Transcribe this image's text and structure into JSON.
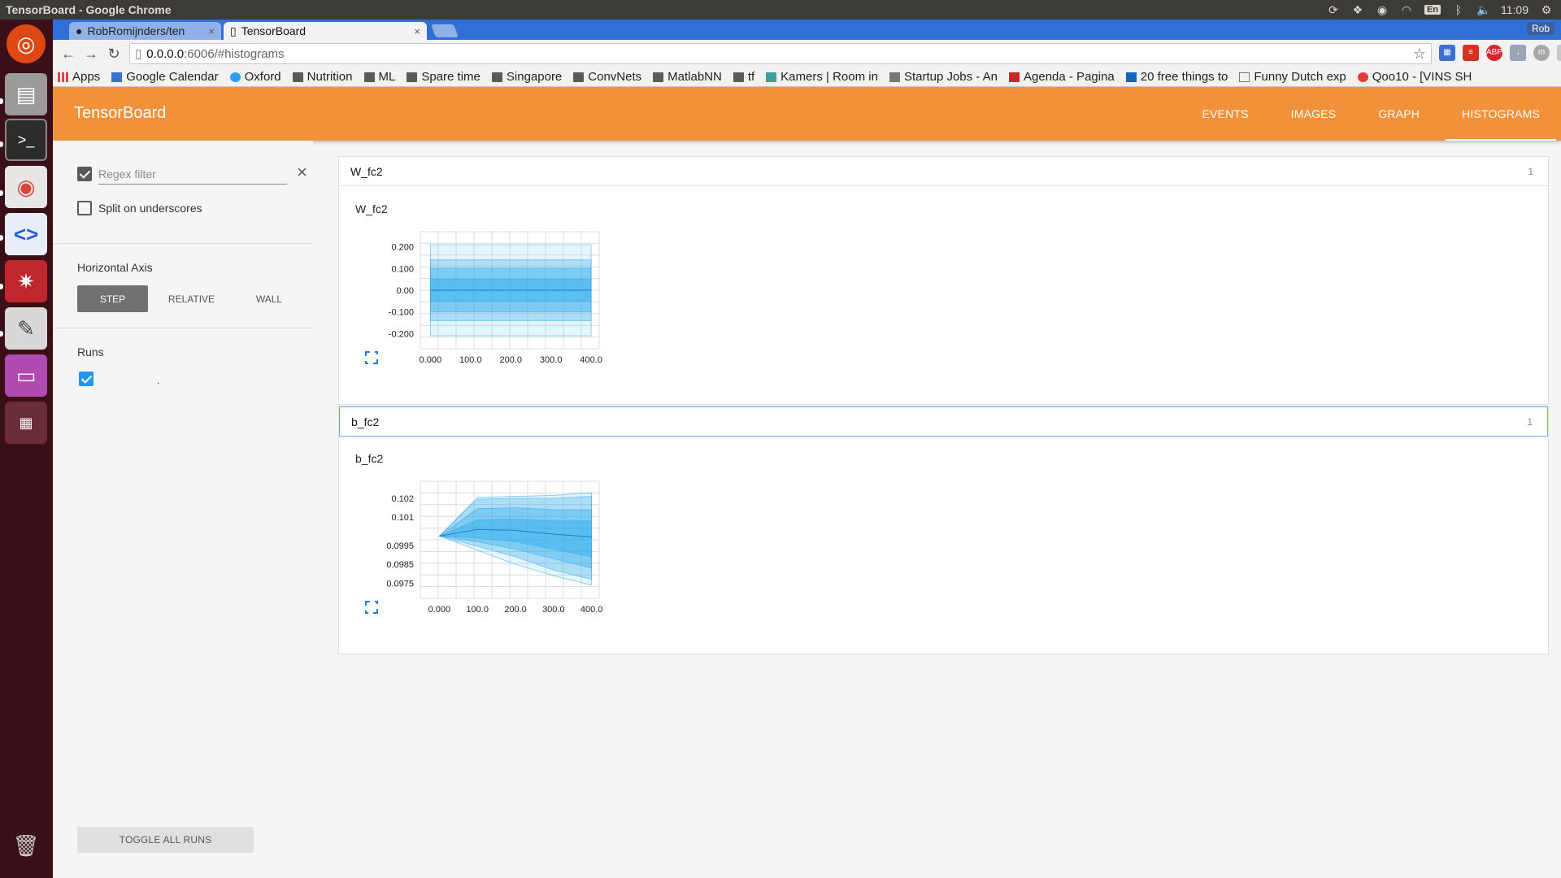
{
  "os": {
    "window_title": "TensorBoard - Google Chrome",
    "clock": "11:09",
    "keyboard_lang": "En"
  },
  "browser": {
    "tabs": [
      {
        "label": "RobRomijnders/ten",
        "active": false
      },
      {
        "label": "TensorBoard",
        "active": true
      }
    ],
    "user": "Rob",
    "url_host": "0.0.0.0",
    "url_path": ":6006/#histograms",
    "bookmarks": [
      {
        "label": "Apps",
        "icon": "apps-grid-icon"
      },
      {
        "label": "Google Calendar",
        "icon": "calendar-icon"
      },
      {
        "label": "Oxford",
        "icon": "oxford-icon"
      },
      {
        "label": "Nutrition",
        "icon": "folder-icon"
      },
      {
        "label": "ML",
        "icon": "folder-icon"
      },
      {
        "label": "Spare time",
        "icon": "folder-icon"
      },
      {
        "label": "Singapore",
        "icon": "folder-icon"
      },
      {
        "label": "ConvNets",
        "icon": "folder-icon"
      },
      {
        "label": "MatlabNN",
        "icon": "folder-icon"
      },
      {
        "label": "tf",
        "icon": "folder-icon"
      },
      {
        "label": "Kamers | Room in",
        "icon": "site-icon"
      },
      {
        "label": "Startup Jobs - An",
        "icon": "site-icon"
      },
      {
        "label": "Agenda - Pagina",
        "icon": "site-icon"
      },
      {
        "label": "20 free things to",
        "icon": "site-icon"
      },
      {
        "label": "Funny Dutch exp",
        "icon": "page-icon"
      },
      {
        "label": "Qoo10 - [VINS SH",
        "icon": "site-icon"
      }
    ]
  },
  "tensorboard": {
    "title": "TensorBoard",
    "nav": [
      {
        "label": "EVENTS",
        "active": false
      },
      {
        "label": "IMAGES",
        "active": false
      },
      {
        "label": "GRAPH",
        "active": false
      },
      {
        "label": "HISTOGRAMS",
        "active": true
      }
    ],
    "sidebar": {
      "regex_placeholder": "Regex filter",
      "regex_checked": true,
      "split_label": "Split on underscores",
      "axis_title": "Horizontal Axis",
      "axis_options": [
        "STEP",
        "RELATIVE",
        "WALL"
      ],
      "axis_selected": "STEP",
      "runs_title": "Runs",
      "runs": [
        {
          "name": ".",
          "checked": true
        }
      ],
      "toggle_label": "TOGGLE ALL RUNS"
    },
    "accent_color": "#f3913b",
    "histogram_color": "#29a9eb"
  },
  "chart_data": [
    {
      "type": "area",
      "card_title": "W_fc2",
      "card_count": "1",
      "title": "W_fc2",
      "x": [
        0,
        100,
        200,
        300,
        400
      ],
      "x_ticks": [
        "0.000",
        "100.0",
        "200.0",
        "300.0",
        "400.0"
      ],
      "y_ticks": [
        "0.200",
        "0.100",
        "0.00",
        "-0.100",
        "-0.200"
      ],
      "ylim": [
        -0.27,
        0.27
      ],
      "xlim": [
        -25,
        420
      ],
      "series": [
        {
          "values_low": [
            -0.21,
            -0.21,
            -0.21,
            -0.21,
            -0.21
          ],
          "values_high": [
            0.21,
            0.21,
            0.21,
            0.21,
            0.21
          ]
        },
        {
          "values_low": [
            -0.14,
            -0.14,
            -0.14,
            -0.14,
            -0.14
          ],
          "values_high": [
            0.14,
            0.14,
            0.14,
            0.14,
            0.14
          ]
        },
        {
          "values_low": [
            -0.1,
            -0.1,
            -0.1,
            -0.1,
            -0.1
          ],
          "values_high": [
            0.1,
            0.1,
            0.1,
            0.1,
            0.1
          ]
        },
        {
          "values_low": [
            -0.05,
            -0.05,
            -0.05,
            -0.05,
            -0.05
          ],
          "values_high": [
            0.05,
            0.05,
            0.05,
            0.05,
            0.05
          ]
        }
      ],
      "median": [
        0.0,
        0.0,
        0.0,
        0.0,
        0.0
      ],
      "grid": true
    },
    {
      "type": "area",
      "card_title": "b_fc2",
      "card_count": "1",
      "title": "b_fc2",
      "x": [
        0,
        100,
        200,
        300,
        400
      ],
      "x_ticks": [
        "0.000",
        "100.0",
        "200.0",
        "300.0",
        "400.0"
      ],
      "y_ticks": [
        "0.102",
        "0.101",
        "0.0995",
        "0.0985",
        "0.0975"
      ],
      "y_tick_values": [
        0.102,
        0.101,
        0.0995,
        0.0985,
        0.0975
      ],
      "ylim": [
        0.0967,
        0.1029
      ],
      "xlim": [
        -50,
        420
      ],
      "series": [
        {
          "values_low": [
            0.1,
            0.09925,
            0.0985,
            0.0979,
            0.0974
          ],
          "values_high": [
            0.1,
            0.10205,
            0.1021,
            0.10215,
            0.1023
          ]
        },
        {
          "values_low": [
            0.1,
            0.09945,
            0.0989,
            0.0982,
            0.0977
          ],
          "values_high": [
            0.1,
            0.10195,
            0.102,
            0.102,
            0.1021
          ]
        },
        {
          "values_low": [
            0.1,
            0.0997,
            0.0993,
            0.0988,
            0.0983
          ],
          "values_high": [
            0.1,
            0.10145,
            0.1015,
            0.1014,
            0.1014
          ]
        },
        {
          "values_low": [
            0.1,
            0.0999,
            0.0997,
            0.0993,
            0.0989
          ],
          "values_high": [
            0.1,
            0.10085,
            0.1009,
            0.1008,
            0.1008
          ]
        }
      ],
      "median": [
        0.1,
        0.10035,
        0.1003,
        0.1001,
        0.09995
      ],
      "grid": true
    }
  ]
}
